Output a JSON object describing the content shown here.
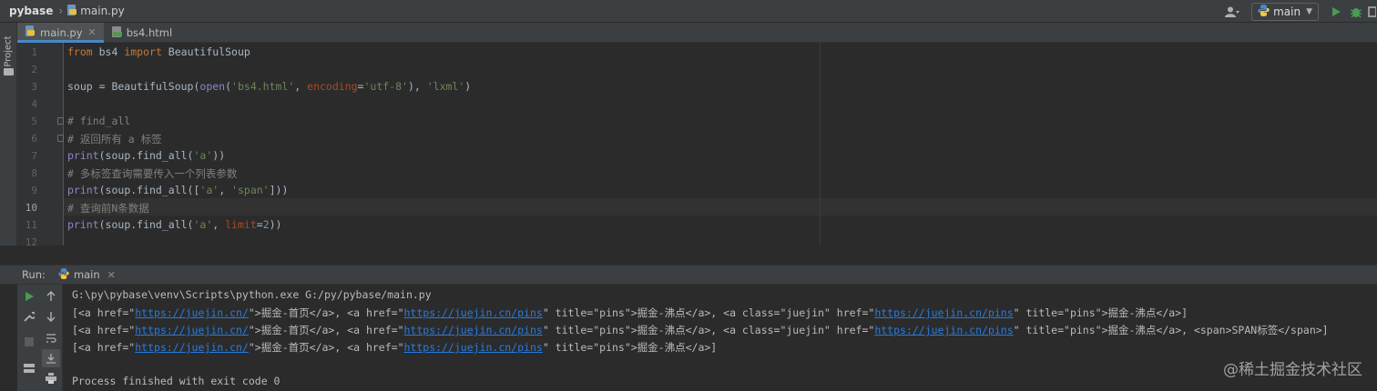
{
  "navbar": {
    "project": "pybase",
    "file": "main.py",
    "run_config": "main"
  },
  "sidebar": {
    "project_tab": "Project"
  },
  "tabs": [
    {
      "label": "main.py",
      "active": true
    },
    {
      "label": "bs4.html",
      "active": false
    }
  ],
  "editor": {
    "line_numbers": [
      "1",
      "2",
      "3",
      "4",
      "5",
      "6",
      "7",
      "8",
      "9",
      "10",
      "11",
      "12"
    ],
    "current_line": "10",
    "code": {
      "l1": {
        "kw1": "from",
        "mod": " bs4 ",
        "kw2": "import",
        "name": " BeautifulSoup"
      },
      "l3": {
        "a": "soup = BeautifulSoup(",
        "b": "open",
        "c": "(",
        "d": "'bs4.html'",
        "e": ", ",
        "f": "encoding",
        "g": "=",
        "h": "'utf-8'",
        "i": "), ",
        "j": "'lxml'",
        "k": ")"
      },
      "l5": "# find_all",
      "l6": "# 返回所有 a 标签",
      "l7": {
        "a": "print",
        "b": "(soup.find_all(",
        "c": "'a'",
        "d": "))"
      },
      "l8": "# 多标签查询需要传入一个列表参数",
      "l9": {
        "a": "print",
        "b": "(soup.find_all([",
        "c": "'a'",
        "d": ", ",
        "e": "'span'",
        "f": "]))"
      },
      "l10": "# 查询前N条数据",
      "l11": {
        "a": "print",
        "b": "(soup.find_all(",
        "c": "'a'",
        "d": ", ",
        "e": "limit",
        "f": "=",
        "g": "2",
        "h": "))"
      }
    }
  },
  "run": {
    "label": "Run:",
    "tab": "main",
    "console": {
      "cmd": "G:\\py\\pybase\\venv\\Scripts\\python.exe G:/py/pybase/main.py",
      "out1": {
        "p1": "[<a href=\"",
        "u1": "https://juejin.cn/",
        "p2": "\">掘金-首页</a>, <a href=\"",
        "u2": "https://juejin.cn/pins",
        "p3": "\" title=\"pins\">掘金-沸点</a>, <a class=\"juejin\" href=\"",
        "u3": "https://juejin.cn/pins",
        "p4": "\" title=\"pins\">掘金-沸点</a>]"
      },
      "out2": {
        "p1": "[<a href=\"",
        "u1": "https://juejin.cn/",
        "p2": "\">掘金-首页</a>, <a href=\"",
        "u2": "https://juejin.cn/pins",
        "p3": "\" title=\"pins\">掘金-沸点</a>, <a class=\"juejin\" href=\"",
        "u3": "https://juejin.cn/pins",
        "p4": "\" title=\"pins\">掘金-沸点</a>, <span>SPAN标签</span>]"
      },
      "out3": {
        "p1": "[<a href=\"",
        "u1": "https://juejin.cn/",
        "p2": "\">掘金-首页</a>, <a href=\"",
        "u2": "https://juejin.cn/pins",
        "p3": "\" title=\"pins\">掘金-沸点</a>]"
      },
      "exit": "Process finished with exit code 0"
    }
  },
  "watermark": "@稀土掘金技术社区",
  "colors": {
    "keyword": "#cc7832",
    "string": "#6a8759",
    "comment": "#808080",
    "builtin": "#8888c6",
    "link": "#287bde",
    "run_green": "#499c54",
    "python_blue": "#4a88c7"
  }
}
